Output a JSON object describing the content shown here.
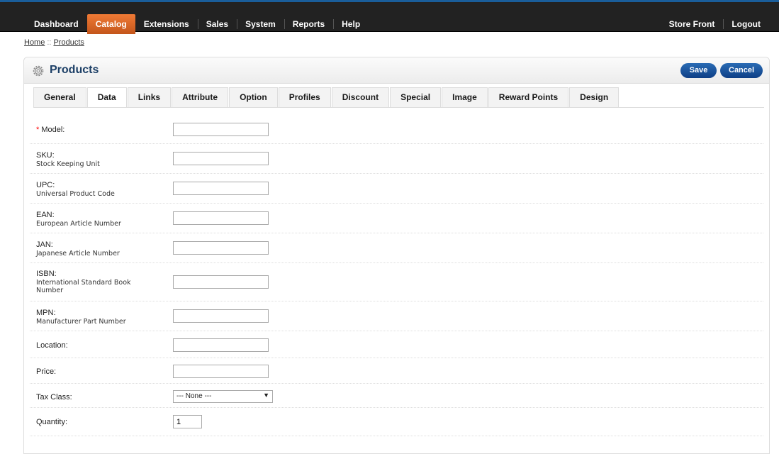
{
  "nav": {
    "left": [
      "Dashboard",
      "Catalog",
      "Extensions",
      "Sales",
      "System",
      "Reports",
      "Help"
    ],
    "active": "Catalog",
    "right": [
      "Store Front",
      "Logout"
    ]
  },
  "breadcrumb": {
    "home": "Home",
    "separator": "::",
    "current": "Products"
  },
  "panel": {
    "title": "Products",
    "save_label": "Save",
    "cancel_label": "Cancel"
  },
  "tabs": [
    "General",
    "Data",
    "Links",
    "Attribute",
    "Option",
    "Profiles",
    "Discount",
    "Special",
    "Image",
    "Reward Points",
    "Design"
  ],
  "active_tab": "Data",
  "fields": {
    "model": {
      "required_mark": "*",
      "label": "Model:",
      "value": ""
    },
    "sku": {
      "label": "SKU:",
      "help": "Stock Keeping Unit",
      "value": ""
    },
    "upc": {
      "label": "UPC:",
      "help": "Universal Product Code",
      "value": ""
    },
    "ean": {
      "label": "EAN:",
      "help": "European Article Number",
      "value": ""
    },
    "jan": {
      "label": "JAN:",
      "help": "Japanese Article Number",
      "value": ""
    },
    "isbn": {
      "label": "ISBN:",
      "help": "International Standard Book Number",
      "value": ""
    },
    "mpn": {
      "label": "MPN:",
      "help": "Manufacturer Part Number",
      "value": ""
    },
    "location": {
      "label": "Location:",
      "value": ""
    },
    "price": {
      "label": "Price:",
      "value": ""
    },
    "tax_class": {
      "label": "Tax Class:",
      "selected": "--- None ---"
    },
    "quantity": {
      "label": "Quantity:",
      "value": "1"
    }
  },
  "colors": {
    "accent_tab": "#e0662a",
    "button": "#1a4f96",
    "title": "#1c3f66",
    "required": "#ff0000"
  }
}
